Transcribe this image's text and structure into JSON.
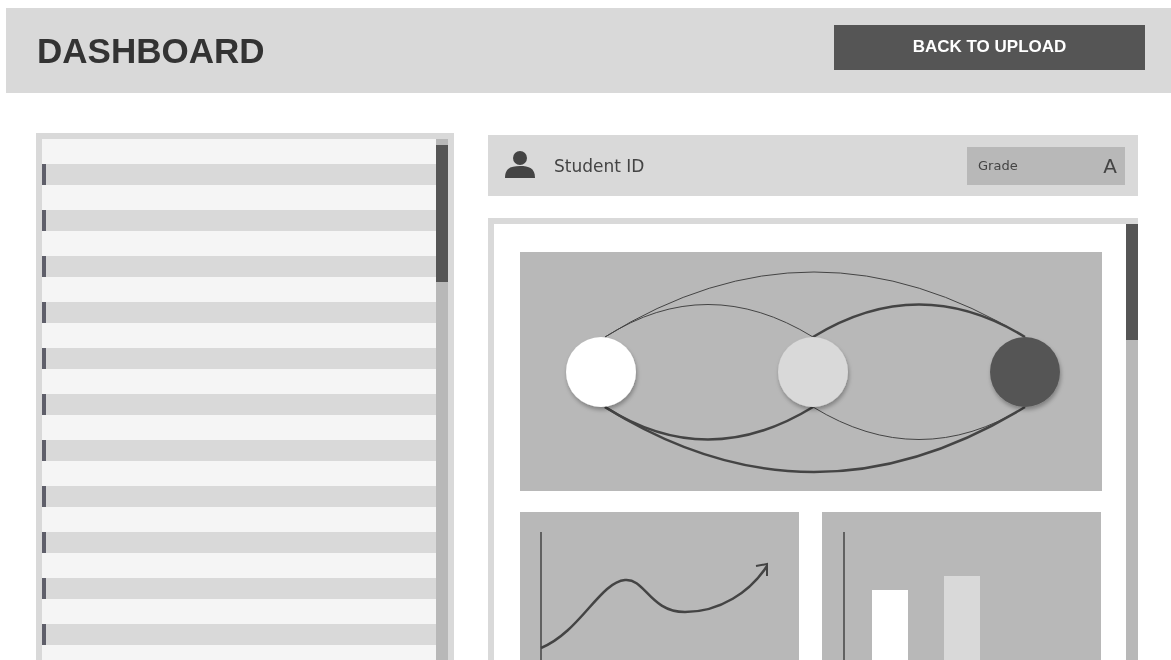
{
  "header": {
    "title": "DASHBOARD",
    "button": "BACK TO UPLOAD"
  },
  "student": {
    "label": "Student ID",
    "grade_label": "Grade",
    "grade": "A"
  },
  "network": {
    "nodes": [
      {
        "color": "#ffffff"
      },
      {
        "color": "#d9d9d9"
      },
      {
        "color": "#555555"
      }
    ]
  }
}
